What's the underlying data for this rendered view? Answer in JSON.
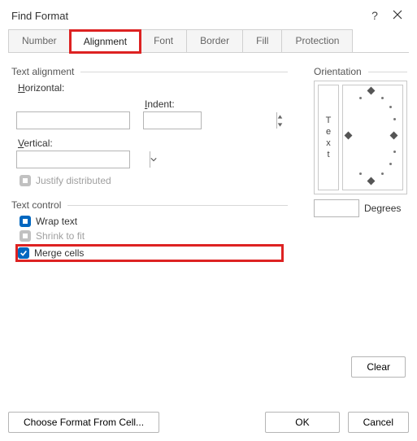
{
  "dialog": {
    "title": "Find Format",
    "help": "?",
    "tabs": [
      "Number",
      "Alignment",
      "Font",
      "Border",
      "Fill",
      "Protection"
    ],
    "active_tab_index": 1
  },
  "text_alignment": {
    "group": "Text alignment",
    "horizontal_label": "Horizontal:",
    "horizontal_value": "",
    "indent_label": "Indent:",
    "indent_value": "",
    "vertical_label": "Vertical:",
    "vertical_value": "",
    "justify_label": "Justify distributed",
    "justify_state": "tristate-disabled"
  },
  "text_control": {
    "group": "Text control",
    "wrap_label": "Wrap text",
    "wrap_state": "tristate",
    "shrink_label": "Shrink to fit",
    "shrink_state": "tristate-disabled",
    "merge_label": "Merge cells",
    "merge_state": "checked"
  },
  "orientation": {
    "group": "Orientation",
    "vertical_text": [
      "T",
      "e",
      "x",
      "t"
    ],
    "degrees_value": "",
    "degrees_label": "Degrees"
  },
  "buttons": {
    "clear": "Clear",
    "choose_format": "Choose Format From Cell...",
    "ok": "OK",
    "cancel": "Cancel"
  },
  "highlights": {
    "tab_alignment": true,
    "merge_cells": true
  }
}
